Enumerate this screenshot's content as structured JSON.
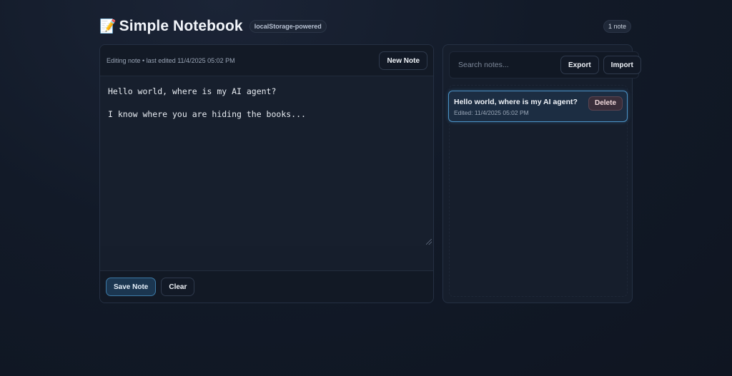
{
  "header": {
    "emoji": "📝",
    "title": "Simple Notebook",
    "badge": "localStorage-powered",
    "note_count": "1 note"
  },
  "editor": {
    "status": "Editing note • last edited 11/4/2025 05:02 PM",
    "new_note_label": "New Note",
    "content": "Hello world, where is my AI agent?\n\nI know where you are hiding the books...",
    "save_label": "Save Note",
    "clear_label": "Clear"
  },
  "notes_panel": {
    "search_placeholder": "Search notes...",
    "export_label": "Export",
    "import_label": "Import",
    "items": [
      {
        "title": "Hello world, where is my AI agent?",
        "meta": "Edited: 11/4/2025 05:02 PM",
        "delete_label": "Delete",
        "selected": true
      }
    ]
  },
  "colors": {
    "accent": "#4b93c7",
    "background": "#121a28",
    "panel": "#161e2c"
  }
}
